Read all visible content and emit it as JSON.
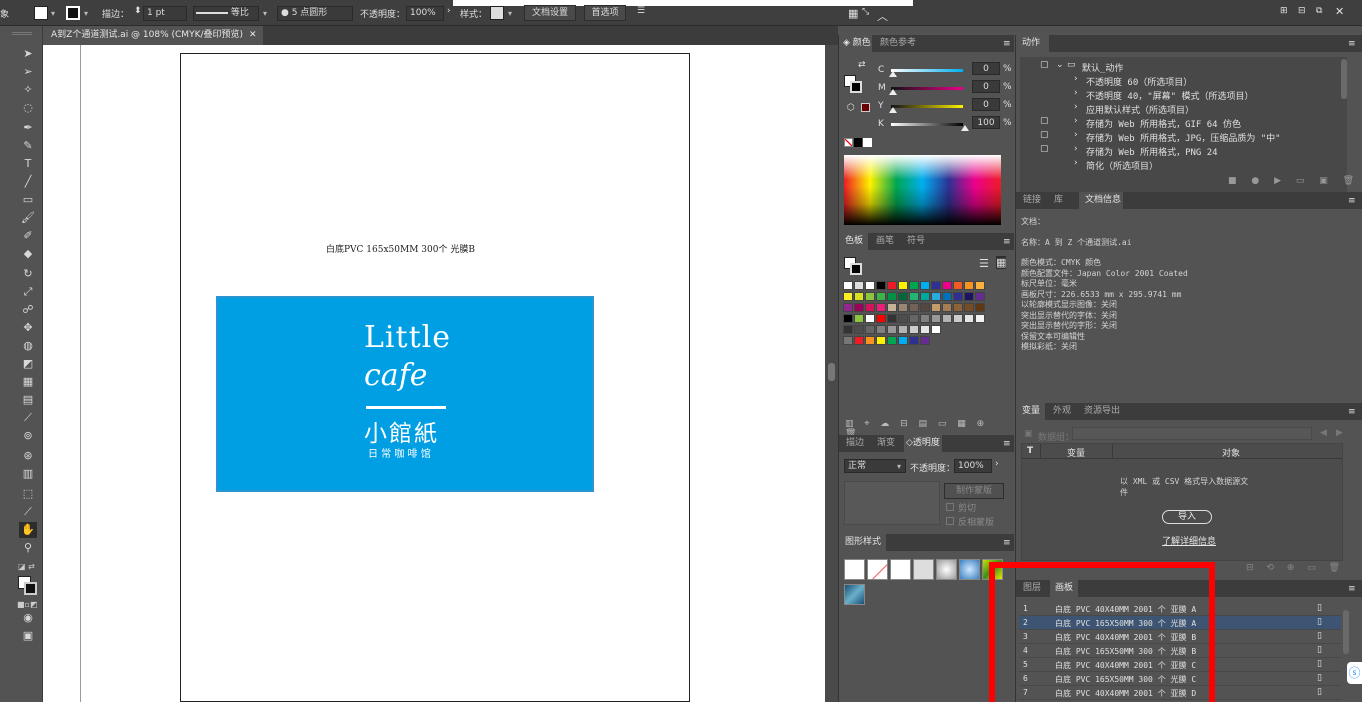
{
  "toolbar": {
    "cut_label": "象",
    "stroke_label": "描边：",
    "stroke_weight": "1 pt",
    "stroke_profile": "等比",
    "brush": "5 点圆形",
    "opacity_label": "不透明度：",
    "opacity_value": "100%",
    "style_label": "样式：",
    "doc_setup": "文档设置",
    "prefs": "首选项"
  },
  "document": {
    "tab_title": "A到Z个通道测试.ai @ 108% (CMYK/叠印预览)"
  },
  "artboard": {
    "caption": "白底PVC 165x50MM 300个 光膜B",
    "logo_line1": "Little",
    "logo_line2": "cafe",
    "logo_cn": "小館紙",
    "logo_sub": "日 常 咖 啡 馆"
  },
  "color_panel": {
    "tab1": "颜色",
    "tab2": "颜色参考",
    "channels": [
      {
        "k": "C",
        "v": "0",
        "f": 0
      },
      {
        "k": "M",
        "v": "0",
        "f": 0
      },
      {
        "k": "Y",
        "v": "0",
        "f": 0
      },
      {
        "k": "K",
        "v": "100",
        "f": 1
      }
    ],
    "pct": "%"
  },
  "swatch_panel": {
    "tab1": "色板",
    "tab2": "画笔",
    "tab3": "符号"
  },
  "transparency": {
    "tab1": "描边",
    "tab2": "渐变",
    "tab3": "透明度",
    "blend": "正常",
    "opacity_label": "不透明度：",
    "opacity": "100%",
    "make_mask": "制作蒙版",
    "clip": "剪切",
    "invert": "反相蒙版"
  },
  "graphic_styles": {
    "title": "图形样式"
  },
  "actions": {
    "title": "动作",
    "items": [
      "默认_动作",
      "不透明度 60（所选项目）",
      "不透明度 40，\"屏幕\" 模式（所选项目）",
      "应用默认样式（所选项目）",
      "存储为 Web 所用格式，GIF 64 仿色",
      "存储为 Web 所用格式，JPG，压缩品质为 \"中\"",
      "存储为 Web 所用格式，PNG 24",
      "简化（所选项目）"
    ]
  },
  "doc_info": {
    "tab1": "链接",
    "tab2": "库",
    "tab3": "文档信息",
    "lines": [
      "文档：",
      "名称：A 到 Z 个通道测试.ai",
      "颜色模式：CMYK 颜色",
      "颜色配置文件：Japan Color 2001 Coated",
      "标尺单位：毫米",
      "画板尺寸：226.6533 mm x 295.9741 mm",
      "以轮廓模式显示图像：关闭",
      "突出显示替代的字体：关闭",
      "突出显示替代的字形：关闭",
      "保留文本可编辑性",
      "模拟彩纸：关闭"
    ]
  },
  "variables": {
    "tab1": "变量",
    "tab2": "外观",
    "tab3": "资源导出",
    "dataset": "数据组：",
    "col_t": "T",
    "col_var": "变量",
    "col_obj": "对象",
    "msg": "以 XML 或 CSV 格式导入数据源文件",
    "import": "导入",
    "learn": "了解详细信息"
  },
  "artboards": {
    "tab1": "图层",
    "tab2": "画板",
    "rows": [
      {
        "n": "1",
        "name": "白底 PVC 40X40MM 2001 个 亚膜 A"
      },
      {
        "n": "2",
        "name": "白底 PVC 165X50MM 300 个 光膜 A"
      },
      {
        "n": "3",
        "name": "白底 PVC 40X40MM 2001 个 亚膜 B"
      },
      {
        "n": "4",
        "name": "白底 PVC 165X50MM 300 个 光膜 B"
      },
      {
        "n": "5",
        "name": "白底 PVC 40X40MM 2001 个 亚膜 C"
      },
      {
        "n": "6",
        "name": "白底 PVC 165X50MM 300 个 光膜 C"
      },
      {
        "n": "7",
        "name": "白底 PVC 40X40MM 2001 个 亚膜 D"
      }
    ]
  },
  "colors": {
    "accent": "#009fe3",
    "highlight": "#ff0000"
  }
}
